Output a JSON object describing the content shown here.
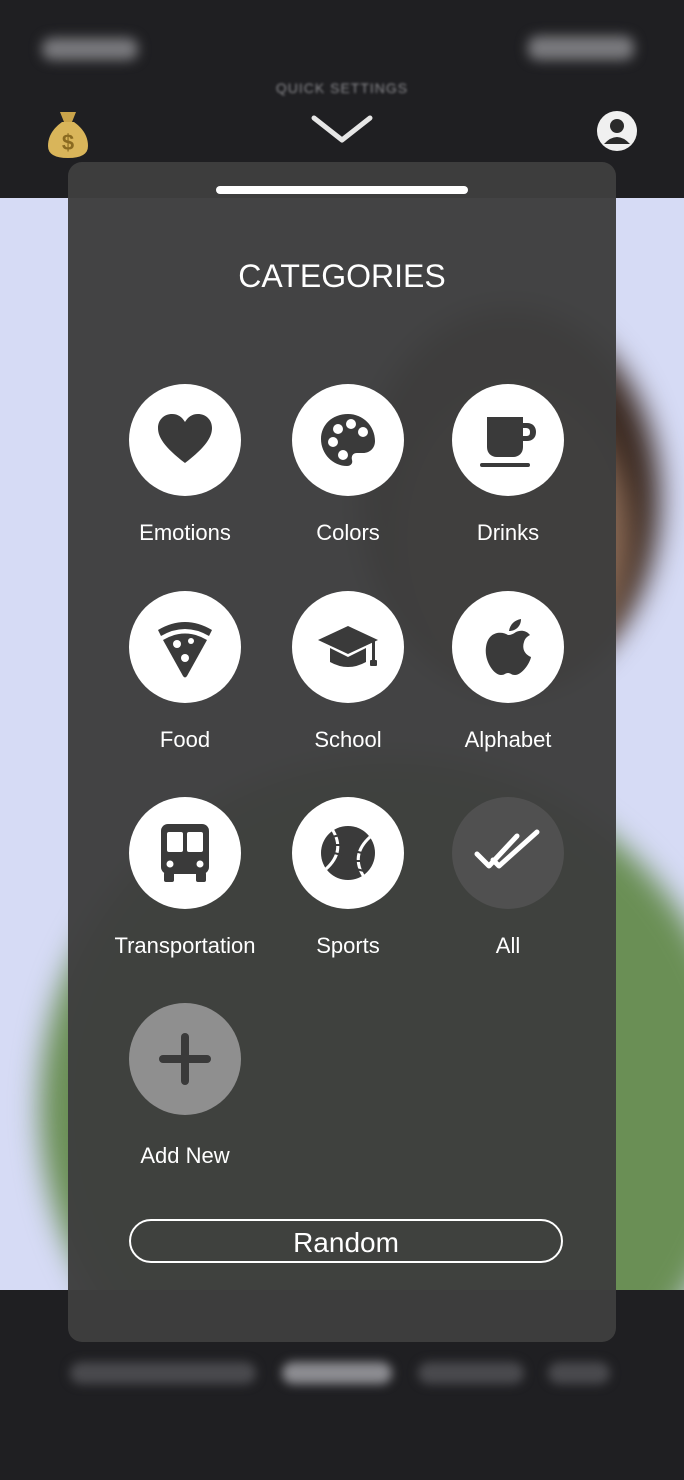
{
  "header": {
    "quick_settings_label": "QUICK SETTINGS"
  },
  "sheet": {
    "title": "CATEGORIES",
    "categories": [
      {
        "label": "Emotions",
        "icon": "heart-icon"
      },
      {
        "label": "Colors",
        "icon": "palette-icon"
      },
      {
        "label": "Drinks",
        "icon": "coffee-cup-icon"
      },
      {
        "label": "Food",
        "icon": "pizza-icon"
      },
      {
        "label": "School",
        "icon": "graduation-cap-icon"
      },
      {
        "label": "Alphabet",
        "icon": "apple-icon"
      },
      {
        "label": "Transportation",
        "icon": "bus-icon"
      },
      {
        "label": "Sports",
        "icon": "baseball-icon"
      },
      {
        "label": "All",
        "icon": "double-check-icon"
      },
      {
        "label": "Add New",
        "icon": "plus-icon"
      }
    ],
    "random_label": "Random"
  },
  "colors": {
    "sheet_bg": "#3e3e3e",
    "circle_bg": "#ffffff",
    "all_circle_bg": "#505050",
    "add_new_circle_bg": "#8f8f8f",
    "icon_color": "#3a3a3a",
    "photo_bg": "#d6dbf5",
    "shirt_green": "#6a8f55"
  }
}
